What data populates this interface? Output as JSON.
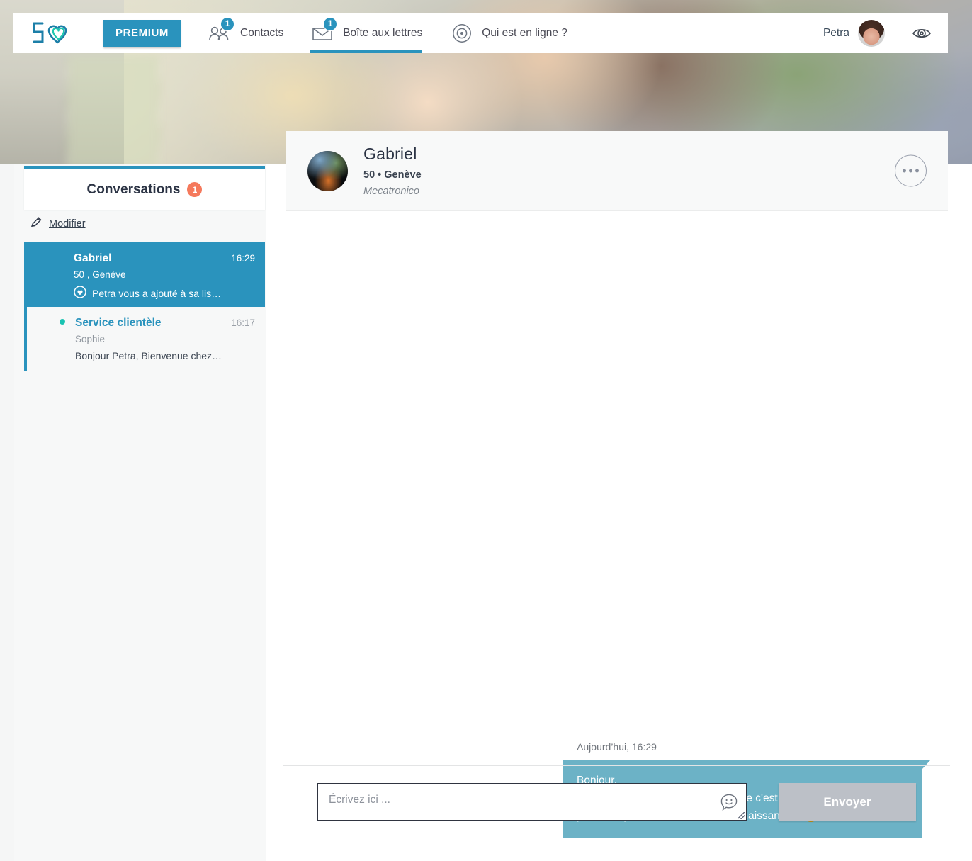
{
  "header": {
    "logo_name": "50-hearts-logo",
    "premium_label": "PREMIUM",
    "nav": [
      {
        "id": "contacts",
        "label": "Contacts",
        "badge": "1",
        "icon": "contacts-icon",
        "active": false
      },
      {
        "id": "mailbox",
        "label": "Boîte aux lettres",
        "badge": "1",
        "icon": "envelope-icon",
        "active": true
      },
      {
        "id": "online",
        "label": "Qui est en ligne ?",
        "badge": "",
        "icon": "radar-icon",
        "active": false
      }
    ],
    "user_name": "Petra",
    "eye_icon": "eye-icon"
  },
  "sidebar": {
    "tab_title": "Conversations",
    "tab_badge": "1",
    "edit_label": "Modifier",
    "edit_icon": "pencil-icon",
    "conversations": [
      {
        "name": "Gabriel",
        "time": "16:29",
        "sub": "50 , Genève",
        "preview": "Petra vous a ajouté à sa lis…",
        "preview_icon": "heart-circle-icon",
        "selected": true,
        "online": false
      },
      {
        "name": "Service clientèle",
        "time": "16:17",
        "sub": "Sophie",
        "preview": "Bonjour Petra, Bienvenue chez…",
        "preview_icon": "",
        "selected": false,
        "online": true
      }
    ]
  },
  "chat": {
    "partner_name": "Gabriel",
    "partner_meta": "50 • Genève",
    "partner_job": "Mecatronico",
    "more_icon": "more-options-icon",
    "timestamp": "Aujourd’hui, 16:29",
    "message_lines": [
      "Bonjour,",
      "j'ai aimé votre photo sur \"Est-ce que c'est l'amour au premier like ?\",",
      "peut-être pourrions-nous faire connaissance ?"
    ],
    "message_emoji": "smiling-face-emoji",
    "composer_placeholder": "Écrivez ici ...",
    "composer_value": "",
    "emoji_button_icon": "emoji-picker-icon",
    "send_label": "Envoyer"
  },
  "colors": {
    "accent": "#2a93bd",
    "badge_orange": "#f5795c",
    "bubble": "#6cb2c6",
    "send_disabled": "#bcc0c7",
    "online_green": "#19c3b2"
  }
}
